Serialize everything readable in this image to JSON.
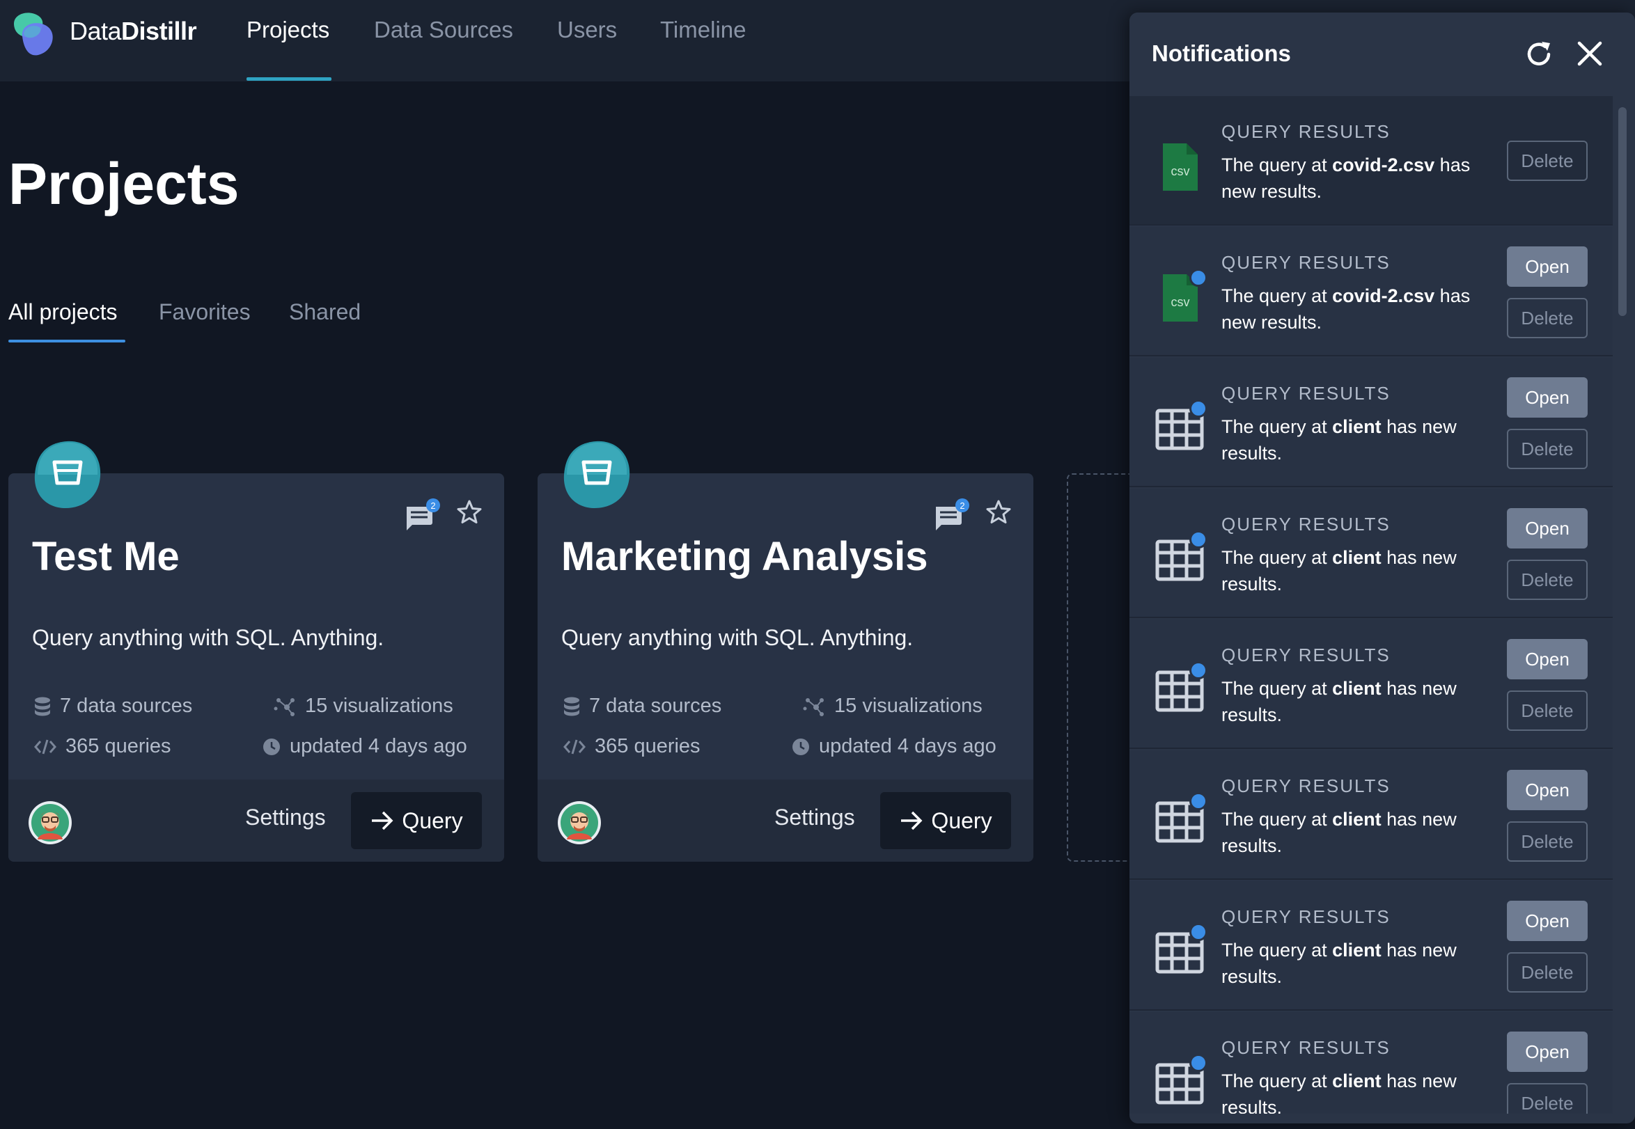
{
  "brand": {
    "name_light": "Data",
    "name_bold": "Distillr"
  },
  "nav": [
    {
      "label": "Projects",
      "active": true
    },
    {
      "label": "Data Sources",
      "active": false
    },
    {
      "label": "Users",
      "active": false
    },
    {
      "label": "Timeline",
      "active": false
    }
  ],
  "page": {
    "title": "Projects"
  },
  "tabs": [
    {
      "label": "All projects",
      "active": true
    },
    {
      "label": "Favorites",
      "active": false
    },
    {
      "label": "Shared",
      "active": false
    }
  ],
  "projects": [
    {
      "title": "Test Me",
      "description": "Query anything with SQL. Anything.",
      "comment_count": "2",
      "stats": {
        "data_sources": "7 data sources",
        "visualizations": "15 visualizations",
        "queries": "365 queries",
        "updated": "updated 4 days ago"
      },
      "settings_label": "Settings",
      "query_label": "Query"
    },
    {
      "title": "Marketing Analysis",
      "description": "Query anything with SQL. Anything.",
      "comment_count": "2",
      "stats": {
        "data_sources": "7 data sources",
        "visualizations": "15 visualizations",
        "queries": "365 queries",
        "updated": "updated 4 days ago"
      },
      "settings_label": "Settings",
      "query_label": "Query"
    }
  ],
  "notifications": {
    "title": "Notifications",
    "items": [
      {
        "kind": "QUERY RESULTS",
        "text_before": "The query at ",
        "target": "covid-2.csv",
        "text_after": " has new results.",
        "icon": "csv-file-icon",
        "unread": false,
        "open_label": "",
        "delete_label": "Delete"
      },
      {
        "kind": "QUERY RESULTS",
        "text_before": "The query at ",
        "target": "covid-2.csv",
        "text_after": " has new results.",
        "icon": "csv-file-icon",
        "unread": true,
        "open_label": "Open",
        "delete_label": "Delete"
      },
      {
        "kind": "QUERY RESULTS",
        "text_before": "The query at ",
        "target": "client",
        "text_after": " has new results.",
        "icon": "table-icon",
        "unread": true,
        "open_label": "Open",
        "delete_label": "Delete"
      },
      {
        "kind": "QUERY RESULTS",
        "text_before": "The query at ",
        "target": "client",
        "text_after": " has new results.",
        "icon": "table-icon",
        "unread": true,
        "open_label": "Open",
        "delete_label": "Delete"
      },
      {
        "kind": "QUERY RESULTS",
        "text_before": "The query at ",
        "target": "client",
        "text_after": " has new results.",
        "icon": "table-icon",
        "unread": true,
        "open_label": "Open",
        "delete_label": "Delete"
      },
      {
        "kind": "QUERY RESULTS",
        "text_before": "The query at ",
        "target": "client",
        "text_after": " has new results.",
        "icon": "table-icon",
        "unread": true,
        "open_label": "Open",
        "delete_label": "Delete"
      },
      {
        "kind": "QUERY RESULTS",
        "text_before": "The query at ",
        "target": "client",
        "text_after": " has new results.",
        "icon": "table-icon",
        "unread": true,
        "open_label": "Open",
        "delete_label": "Delete"
      },
      {
        "kind": "QUERY RESULTS",
        "text_before": "The query at ",
        "target": "client",
        "text_after": " has new results.",
        "icon": "table-icon",
        "unread": true,
        "open_label": "Open",
        "delete_label": "Delete"
      }
    ]
  },
  "icon_labels": {
    "csv": "csv"
  },
  "colors": {
    "background": "#111723",
    "nav_background": "#1b2331",
    "card": "#283245",
    "accent_teal": "#2fa3c2",
    "accent_blue": "#3d8fe0",
    "unread_dot": "#3a8de6",
    "csv_green": "#1d7a43"
  }
}
